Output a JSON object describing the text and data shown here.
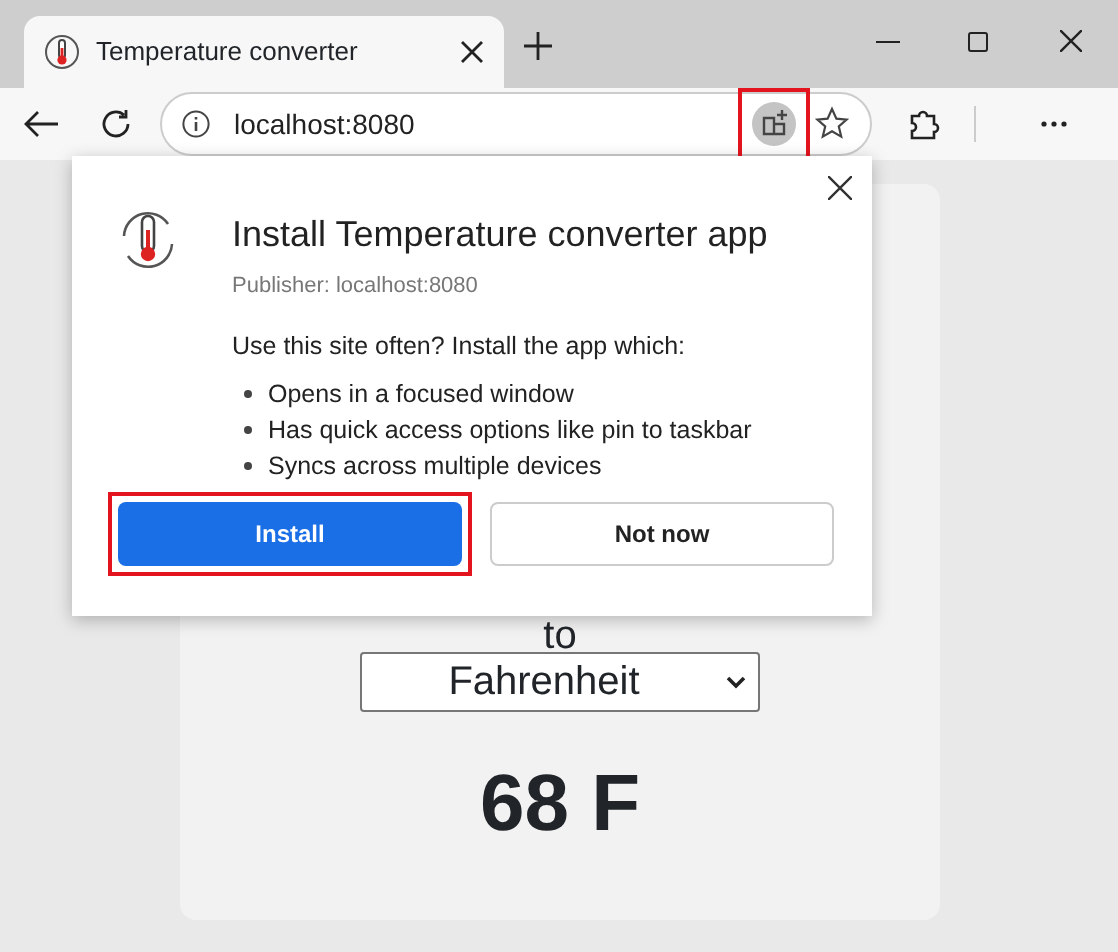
{
  "tab": {
    "title": "Temperature converter",
    "selected": true
  },
  "address_bar": {
    "url": "localhost:8080",
    "install_app_button_highlighted": true
  },
  "install_popup": {
    "title": "Install Temperature converter app",
    "publisher": "Publisher: localhost:8080",
    "intro": "Use this site often? Install the app which:",
    "features": [
      "Opens in a focused window",
      "Has quick access options like pin to taskbar",
      "Syncs across multiple devices"
    ],
    "buttons": [
      {
        "label": "Install",
        "kind": "primary",
        "highlighted": true
      },
      {
        "label": "Not now",
        "kind": "secondary",
        "highlighted": false
      }
    ]
  },
  "page": {
    "to_label": "to",
    "unit_select": {
      "value": "Fahrenheit"
    },
    "result": "68 F"
  }
}
